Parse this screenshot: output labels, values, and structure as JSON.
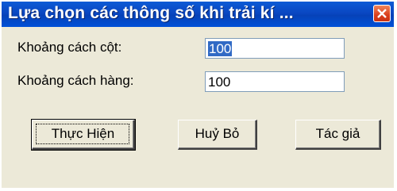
{
  "window": {
    "title": "Lựa chọn các thông số khi trải kí ...",
    "close_icon": "close-icon"
  },
  "form": {
    "column_spacing_label": "Khoảng cách cột:",
    "column_spacing_value": "100",
    "row_spacing_label": "Khoảng cách hàng:",
    "row_spacing_value": "100"
  },
  "buttons": {
    "execute_label": "Thực Hiện",
    "cancel_label": "Huỷ Bỏ",
    "author_label": "Tác giả"
  }
}
